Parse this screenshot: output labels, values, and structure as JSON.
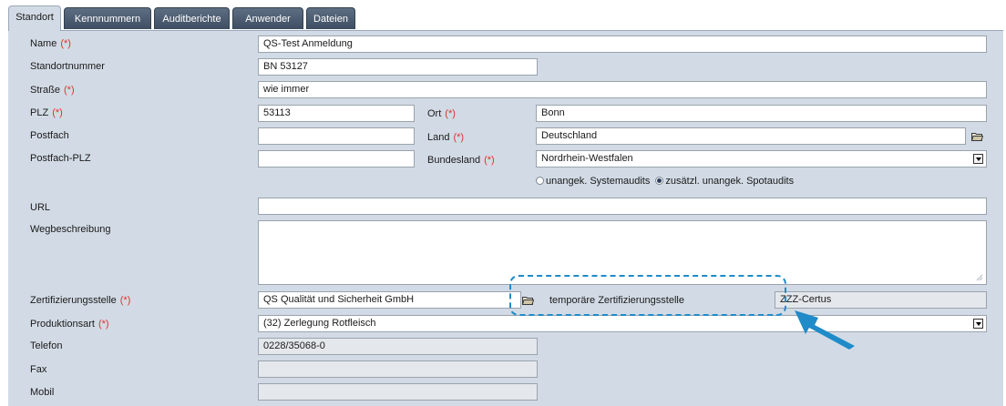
{
  "tabs": [
    "Standort",
    "Kennnummern",
    "Auditberichte",
    "Anwender",
    "Dateien"
  ],
  "required_marker": "(*)",
  "form": {
    "name": {
      "label": "Name",
      "value": "QS-Test Anmeldung"
    },
    "standortnummer": {
      "label": "Standortnummer",
      "value": "BN 53127"
    },
    "strasse": {
      "label": "Straße",
      "value": "wie immer"
    },
    "plz": {
      "label": "PLZ",
      "value": "53113"
    },
    "ort": {
      "label": "Ort",
      "value": "Bonn"
    },
    "postfach": {
      "label": "Postfach",
      "value": ""
    },
    "land": {
      "label": "Land",
      "value": "Deutschland"
    },
    "postfach_plz": {
      "label": "Postfach-PLZ",
      "value": ""
    },
    "bundesland": {
      "label": "Bundesland",
      "value": "Nordrhein-Westfalen"
    },
    "audit_options": {
      "option1": "unangek. Systemaudits",
      "option2": "zusätzl. unangek. Spotaudits",
      "selected": "option2"
    },
    "url": {
      "label": "URL",
      "value": ""
    },
    "wegbeschreibung": {
      "label": "Wegbeschreibung",
      "value": ""
    },
    "zertifizierungsstelle": {
      "label": "Zertifizierungsstelle",
      "value": "QS Qualität und Sicherheit GmbH"
    },
    "temp_zertifizierungsstelle": {
      "label": "temporäre Zertifizierungsstelle",
      "value": "ZZZ-Certus"
    },
    "produktionsart": {
      "label": "Produktionsart",
      "value": "(32) Zerlegung Rotfleisch"
    },
    "telefon": {
      "label": "Telefon",
      "value": "0228/35068-0"
    },
    "fax": {
      "label": "Fax",
      "value": ""
    },
    "mobil": {
      "label": "Mobil",
      "value": ""
    }
  },
  "icons": {
    "folder": "folder-open-icon",
    "dropdown": "chevron-down-icon",
    "annotation": "arrow-icon"
  },
  "colors": {
    "panel": "#d2dbe5",
    "tab": "#4a596d",
    "required": "#e0302e",
    "highlight": "#1f8bc9"
  }
}
